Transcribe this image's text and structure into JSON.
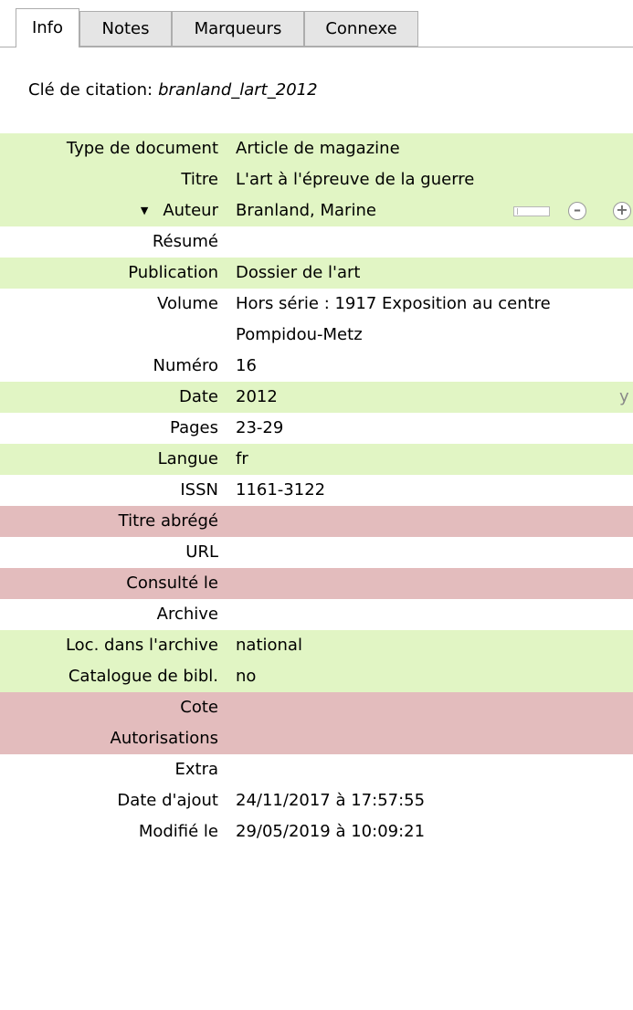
{
  "tabs": [
    {
      "label": "Info"
    },
    {
      "label": "Notes"
    },
    {
      "label": "Marqueurs"
    },
    {
      "label": "Connexe"
    }
  ],
  "citation": {
    "label": "Clé de citation:",
    "value": "branland_lart_2012"
  },
  "fields": {
    "item_type": {
      "label": "Type de document",
      "value": "Article de magazine"
    },
    "title": {
      "label": "Titre",
      "value": "L'art à l'épreuve de la guerre"
    },
    "author": {
      "label": "Auteur",
      "value": "Branland, Marine"
    },
    "abstract": {
      "label": "Résumé",
      "value": ""
    },
    "publication": {
      "label": "Publication",
      "value": "Dossier de l'art"
    },
    "volume": {
      "label": "Volume",
      "value": "Hors série : 1917 Exposition au centre Pompidou-Metz"
    },
    "issue": {
      "label": "Numéro",
      "value": "16"
    },
    "date": {
      "label": "Date",
      "value": "2012",
      "mode": "y"
    },
    "pages": {
      "label": "Pages",
      "value": "23-29"
    },
    "language": {
      "label": "Langue",
      "value": "fr"
    },
    "issn": {
      "label": "ISSN",
      "value": "1161-3122"
    },
    "short_title": {
      "label": "Titre abrégé",
      "value": ""
    },
    "url": {
      "label": "URL",
      "value": ""
    },
    "accessed": {
      "label": "Consulté le",
      "value": ""
    },
    "archive": {
      "label": "Archive",
      "value": ""
    },
    "archive_location": {
      "label": "Loc. dans l'archive",
      "value": "national"
    },
    "library_catalog": {
      "label": "Catalogue de bibl.",
      "value": "no"
    },
    "call_number": {
      "label": "Cote",
      "value": ""
    },
    "rights": {
      "label": "Autorisations",
      "value": ""
    },
    "extra": {
      "label": "Extra",
      "value": ""
    },
    "date_added": {
      "label": "Date d'ajout",
      "value": "24/11/2017 à 17:57:55"
    },
    "modified": {
      "label": "Modifié le",
      "value": "29/05/2019 à 10:09:21"
    }
  },
  "colors": {
    "highlight_green": "#e1f5c4",
    "highlight_red": "#e3bcbd"
  },
  "icons": {
    "author_toggle": "triangle-down-icon",
    "remove": "minus-circle-icon",
    "add": "plus-circle-icon",
    "swap": "creator-swap-icon"
  }
}
